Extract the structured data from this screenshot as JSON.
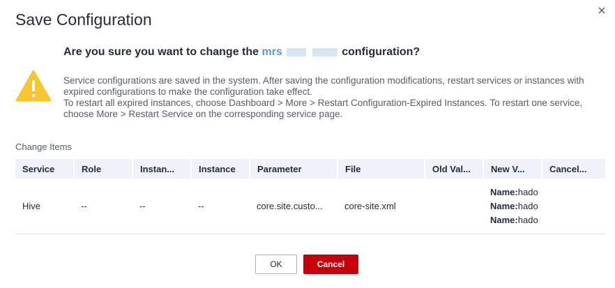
{
  "dialog": {
    "title": "Save Configuration",
    "question_prefix": "Are you sure you want to change the",
    "question_cluster": "mrs",
    "question_suffix": "configuration?",
    "description": [
      "Service configurations are saved in the system. After saving the configuration modifications, restart services or instances with expired configurations to make the configuration take effect.",
      "To restart all expired instances, choose Dashboard > More > Restart Configuration-Expired Instances. To restart one service, choose More > Restart Service on the corresponding service page."
    ],
    "change_items_label": "Change Items",
    "ok_label": "OK",
    "cancel_label": "Cancel"
  },
  "table": {
    "headers": [
      "Service",
      "Role",
      "Instan...",
      "Instance",
      "Parameter",
      "File",
      "Old Val...",
      "New V...",
      "Cancel..."
    ],
    "row": {
      "service": "Hive",
      "role": "--",
      "instan": "--",
      "instance": "--",
      "parameter": "core.site.custo...",
      "file": "core-site.xml",
      "old_value": "",
      "new_value_key": "Name:",
      "new_value_val": "hado",
      "cancel": ""
    }
  },
  "icons": {
    "warning": "warning-triangle-icon",
    "close": "close-icon"
  },
  "colors": {
    "accent_red": "#c7000b",
    "warning_yellow": "#f8c632",
    "highlight_blue": "#5b9bd5"
  }
}
